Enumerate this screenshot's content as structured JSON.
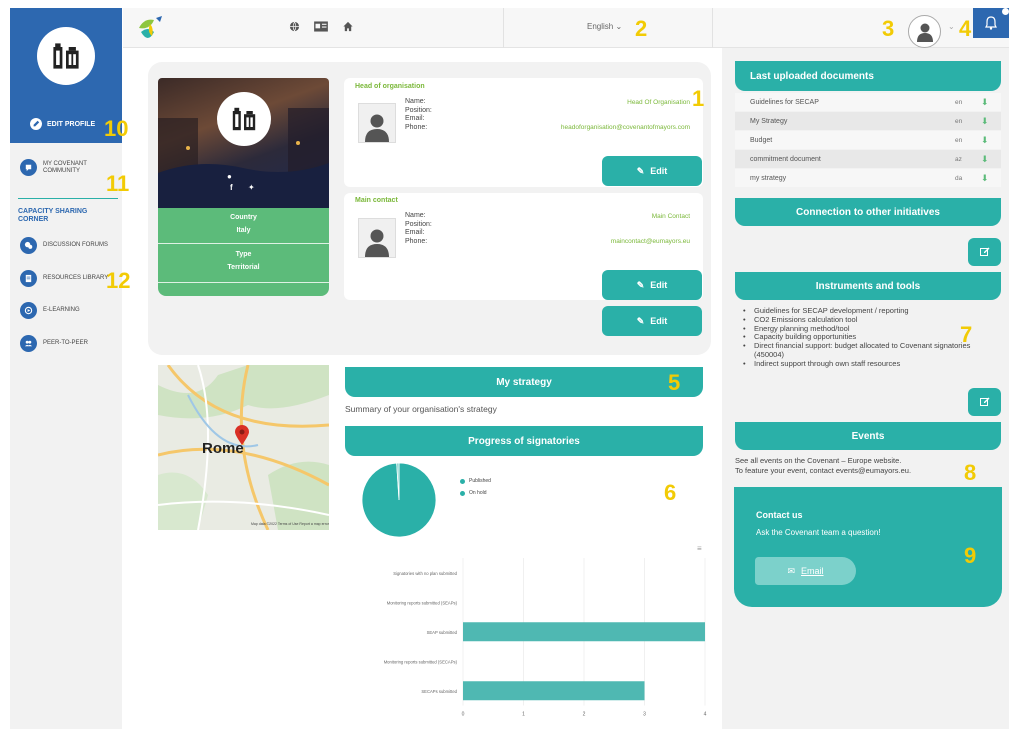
{
  "sidebar": {
    "edit_profile": "EDIT PROFILE",
    "community": "MY COVENANT COMMUNITY",
    "capacity_title": "CAPACITY SHARING CORNER",
    "items": [
      {
        "label": "DISCUSSION FORUMS"
      },
      {
        "label": "RESOURCES LIBRARY"
      },
      {
        "label": "E-LEARNING"
      },
      {
        "label": "PEER-TO-PEER"
      }
    ]
  },
  "topbar": {
    "language": "English"
  },
  "annotations": [
    "1",
    "2",
    "3",
    "4",
    "5",
    "6",
    "7",
    "8",
    "9",
    "10",
    "11",
    "12"
  ],
  "profile": {
    "country_label": "Country",
    "country_value": "Italy",
    "type_label": "Type",
    "type_value": "Territorial"
  },
  "head": {
    "title": "Head of organisation",
    "labels": [
      "Name:",
      "Position:",
      "Email:",
      "Phone:"
    ],
    "name": "Head Of Organisation",
    "email": "headoforganisation@covenantofmayors.com",
    "edit_label": "Edit"
  },
  "main_contact": {
    "title": "Main contact",
    "labels": [
      "Name:",
      "Position:",
      "Email:",
      "Phone:"
    ],
    "name": "Main Contact",
    "email": "maincontact@eumayors.eu",
    "edit_label": "Edit"
  },
  "edit3_label": "Edit",
  "map": {
    "city": "Rome",
    "footer": "Map data ©2022  Terms of Use  Report a map error"
  },
  "strategy": {
    "title": "My strategy",
    "summary": "Summary of your organisation's strategy"
  },
  "progress": {
    "title": "Progress of signatories"
  },
  "chart_data": [
    {
      "type": "pie",
      "labels": [
        "Published",
        "On hold"
      ],
      "values": [
        99,
        1
      ]
    },
    {
      "type": "bar",
      "orientation": "horizontal",
      "categories": [
        "Signatories with no plan submitted",
        "Monitoring reports submitted (SEAPs)",
        "SEAP submitted",
        "Monitoring reports submitted (SECAPs)",
        "SECAPs submitted"
      ],
      "values": [
        0,
        0,
        4,
        0,
        3
      ],
      "xlim": [
        0,
        4
      ],
      "xticks": [
        "0",
        "1",
        "2",
        "3",
        "4"
      ]
    }
  ],
  "documents": {
    "title": "Last uploaded documents",
    "rows": [
      {
        "name": "Guidelines for SECAP",
        "lang": "en"
      },
      {
        "name": "My Strategy",
        "lang": "en"
      },
      {
        "name": "Budget",
        "lang": "en"
      },
      {
        "name": "commitment document",
        "lang": "az"
      },
      {
        "name": "my strategy",
        "lang": "da"
      }
    ]
  },
  "connection": {
    "title": "Connection to other initiatives"
  },
  "instruments": {
    "title": "Instruments and tools",
    "items": [
      "Guidelines for SECAP development / reporting",
      "CO2 Emissions calculation tool",
      "Energy planning method/tool",
      "Capacity building opportunities",
      "Direct financial support: budget allocated to Covenant signatories (450004)",
      "Indirect support through own staff resources"
    ]
  },
  "events": {
    "title": "Events",
    "line1": "See all events on the Covenant – Europe website.",
    "line2": "To feature your event, contact events@eumayors.eu."
  },
  "contact": {
    "title": "Contact us",
    "subtitle": "Ask the Covenant team a question!",
    "email_label": "Email"
  }
}
